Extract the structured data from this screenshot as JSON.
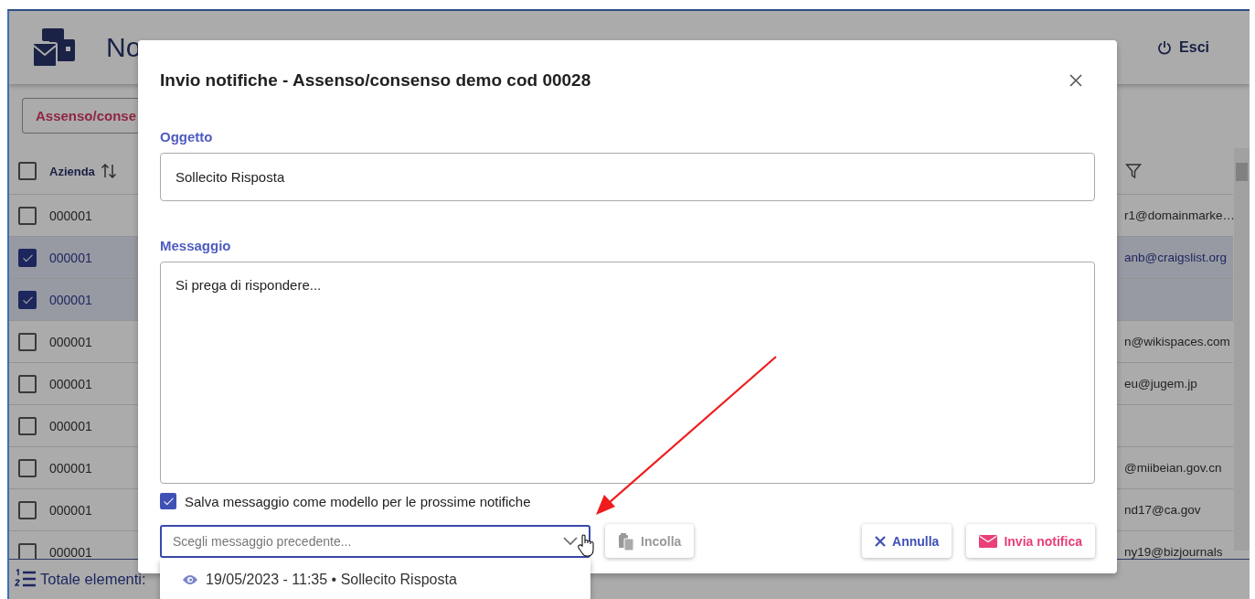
{
  "app": {
    "title": "No",
    "logout": "Esci",
    "tab": "Assenso/conse"
  },
  "table": {
    "columns": [
      {
        "label": "Azienda"
      }
    ],
    "select_all_checked": false,
    "rows": [
      {
        "azienda": "000001",
        "email": "r1@domainmarke…",
        "selected": false
      },
      {
        "azienda": "000001",
        "email": "anb@craigslist.org",
        "selected": true
      },
      {
        "azienda": "000001",
        "selected": true
      },
      {
        "azienda": "000001",
        "email": "n@wikispaces.com",
        "selected": false
      },
      {
        "azienda": "000001",
        "email": "eu@jugem.jp",
        "selected": false
      },
      {
        "azienda": "000001",
        "selected": false
      },
      {
        "azienda": "000001",
        "email": "@miibeian.gov.cn",
        "selected": false
      },
      {
        "azienda": "000001",
        "email": "nd17@ca.gov",
        "selected": false
      },
      {
        "azienda": "000001",
        "email": "ny19@bizjournals",
        "selected": false
      }
    ]
  },
  "footer": {
    "label": "Totale elementi:"
  },
  "dialog": {
    "title": "Invio notifiche - Assenso/consenso demo cod 00028",
    "subject": {
      "label": "Oggetto",
      "value": "Sollecito Risposta"
    },
    "message": {
      "label": "Messaggio",
      "value": "Si prega di rispondere..."
    },
    "save_template": {
      "label": "Salva messaggio come modello per le prossime notifiche",
      "checked": true
    },
    "previous": {
      "placeholder": "Scegli messaggio precedente...",
      "expanded": true,
      "options": [
        {
          "label": "19/05/2023 - 11:35 • Sollecito Risposta"
        }
      ]
    },
    "paste": {
      "label": "Incolla",
      "disabled": true
    },
    "cancel": "Annulla",
    "send": "Invia notifica"
  }
}
